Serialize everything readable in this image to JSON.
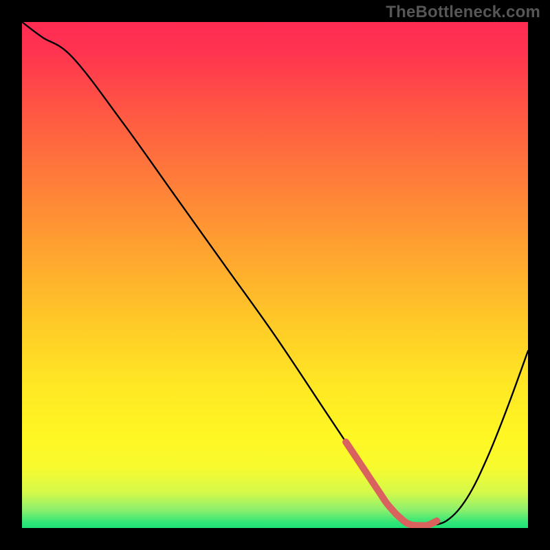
{
  "watermark": "TheBottleneck.com",
  "colors": {
    "page_bg": "#000000",
    "curve": "#000000",
    "marker": "#d9625f",
    "watermark": "#565656"
  },
  "chart_data": {
    "type": "line",
    "title": "",
    "xlabel": "",
    "ylabel": "",
    "xlim": [
      0,
      100
    ],
    "ylim": [
      0,
      100
    ],
    "grid": false,
    "legend": false,
    "annotations": [],
    "series": [
      {
        "name": "curve",
        "x": [
          0,
          4,
          10,
          20,
          30,
          40,
          50,
          60,
          64,
          68,
          72,
          76,
          78,
          80,
          84,
          88,
          92,
          96,
          100
        ],
        "values": [
          100,
          97,
          93,
          80,
          66,
          52,
          38,
          23,
          17,
          11,
          5,
          1,
          0.5,
          0.5,
          1.5,
          6,
          14,
          24,
          35
        ]
      },
      {
        "name": "marker",
        "x": [
          64,
          66,
          68,
          70,
          71,
          72,
          73,
          74,
          75,
          76,
          77,
          78,
          79,
          80,
          81,
          82
        ],
        "values": [
          17.0,
          14.0,
          11.0,
          8.0,
          6.5,
          5.0,
          3.8,
          2.7,
          1.8,
          1.0,
          0.6,
          0.5,
          0.5,
          0.5,
          0.9,
          1.4
        ]
      }
    ]
  }
}
